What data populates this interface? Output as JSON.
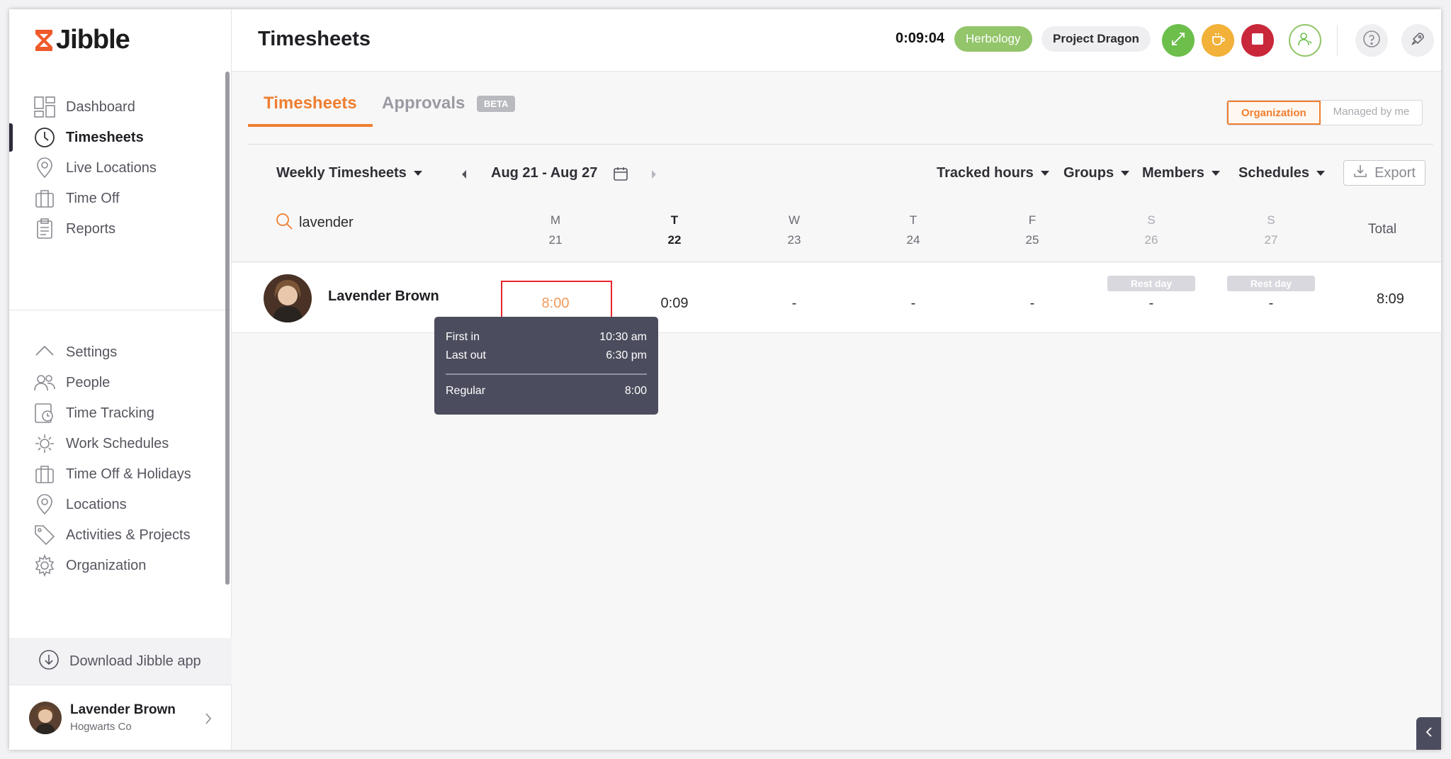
{
  "app": {
    "name": "Jibble"
  },
  "sidebar": {
    "items": [
      {
        "label": "Dashboard"
      },
      {
        "label": "Timesheets"
      },
      {
        "label": "Live Locations"
      },
      {
        "label": "Time Off"
      },
      {
        "label": "Reports"
      },
      {
        "label": "Settings"
      },
      {
        "label": "People"
      },
      {
        "label": "Time Tracking"
      },
      {
        "label": "Work Schedules"
      },
      {
        "label": "Time Off & Holidays"
      },
      {
        "label": "Locations"
      },
      {
        "label": "Activities & Projects"
      },
      {
        "label": "Organization"
      }
    ],
    "active": "Timesheets",
    "download_label": "Download Jibble app",
    "user": {
      "name": "Lavender Brown",
      "org": "Hogwarts Co"
    }
  },
  "header": {
    "title": "Timesheets",
    "timer": "0:09:04",
    "activity": "Herbology",
    "project": "Project Dragon"
  },
  "tabs": {
    "timesheets": "Timesheets",
    "approvals": "Approvals",
    "beta": "BETA"
  },
  "scope": {
    "organization": "Organization",
    "managed": "Managed by me",
    "selected": "Organization"
  },
  "toolbar": {
    "view": "Weekly Timesheets",
    "date_range": "Aug 21 - Aug 27",
    "tracked": "Tracked hours",
    "groups": "Groups",
    "members": "Members",
    "schedules": "Schedules",
    "export": "Export"
  },
  "search": {
    "value": "lavender"
  },
  "days": [
    {
      "d": "M",
      "n": "21"
    },
    {
      "d": "T",
      "n": "22"
    },
    {
      "d": "W",
      "n": "23"
    },
    {
      "d": "T",
      "n": "24"
    },
    {
      "d": "F",
      "n": "25"
    },
    {
      "d": "S",
      "n": "26"
    },
    {
      "d": "S",
      "n": "27"
    }
  ],
  "total_header": "Total",
  "rows": [
    {
      "name": "Lavender Brown",
      "cells": [
        "8:00",
        "0:09",
        "-",
        "-",
        "-",
        "-",
        "-"
      ],
      "rest_day_label": "Rest day",
      "total": "8:09"
    }
  ],
  "tooltip": {
    "first_in_label": "First in",
    "first_in": "10:30 am",
    "last_out_label": "Last out",
    "last_out": "6:30 pm",
    "regular_label": "Regular",
    "regular": "8:00"
  },
  "colors": {
    "accent": "#ef7e2f",
    "activity": "#93c56a",
    "stop": "#c8283a",
    "break": "#f2b138"
  }
}
